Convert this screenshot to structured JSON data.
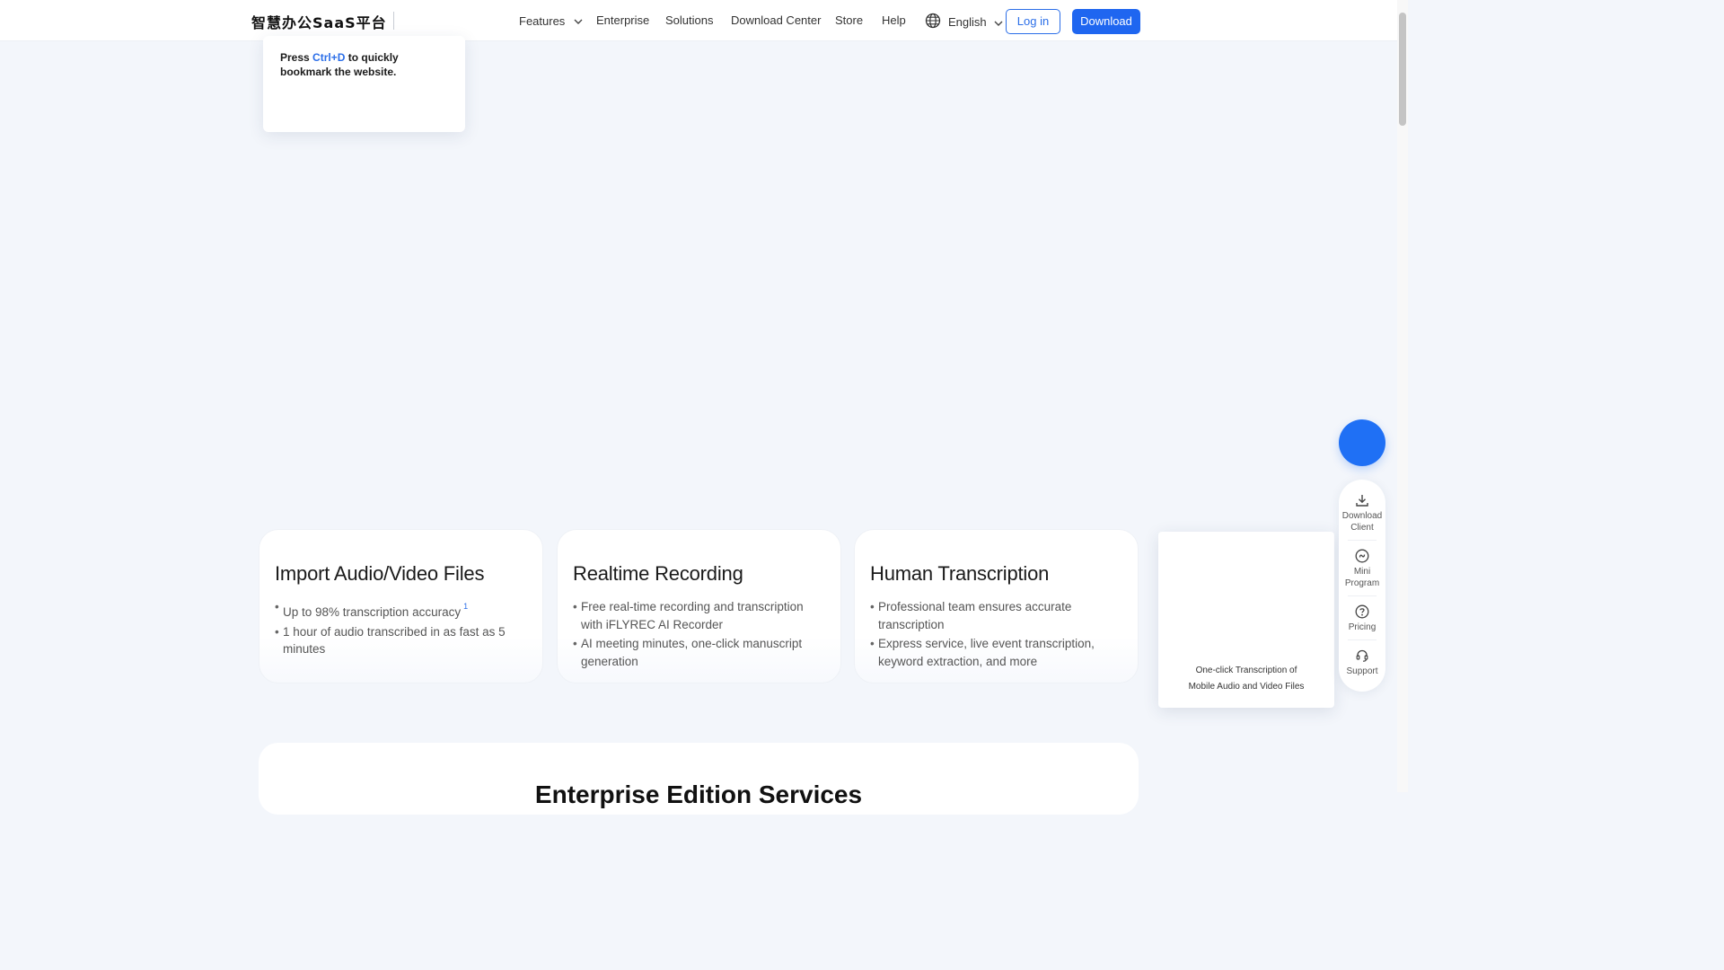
{
  "header": {
    "logo": "智慧办公SaaS平台",
    "nav": [
      "Features",
      "Enterprise",
      "Solutions",
      "Download Center",
      "Store",
      "Help"
    ],
    "language": "English",
    "login": "Log in",
    "download": "Download"
  },
  "tooltip": {
    "prefix": "Press ",
    "shortcut": "Ctrl+D",
    "suffix": " to quickly bookmark the website."
  },
  "cards": [
    {
      "title": "Import Audio/Video Files",
      "bullets": [
        "Up to 98% transcription accuracy",
        "1 hour of audio transcribed in as fast as 5 minutes"
      ],
      "footnote": "1"
    },
    {
      "title": "Realtime Recording",
      "bullets": [
        "Free real-time recording and transcription with iFLYREC AI Recorder",
        "AI meeting minutes, one-click manuscript generation"
      ]
    },
    {
      "title": "Human Transcription",
      "bullets": [
        "Professional team ensures accurate transcription",
        "Express service, live event transcription, keyword extraction, and more"
      ]
    }
  ],
  "qr_popover": {
    "caption_line1": "One-click Transcription of",
    "caption_line2": "Mobile Audio and Video Files"
  },
  "sidebar": {
    "items": [
      {
        "line1": "Download",
        "line2": "Client",
        "icon": "download-icon"
      },
      {
        "line1": "Mini",
        "line2": "Program",
        "icon": "mini-program-icon"
      },
      {
        "line1": "Pricing",
        "line2": "",
        "icon": "question-circle-icon"
      },
      {
        "line1": "Support",
        "line2": "",
        "icon": "headset-icon"
      }
    ]
  },
  "enterprise": {
    "title": "Enterprise Edition Services"
  },
  "colors": {
    "accent": "#1f66f0",
    "page_bg": "#f3f6fb",
    "fab": "#1f70f5"
  }
}
